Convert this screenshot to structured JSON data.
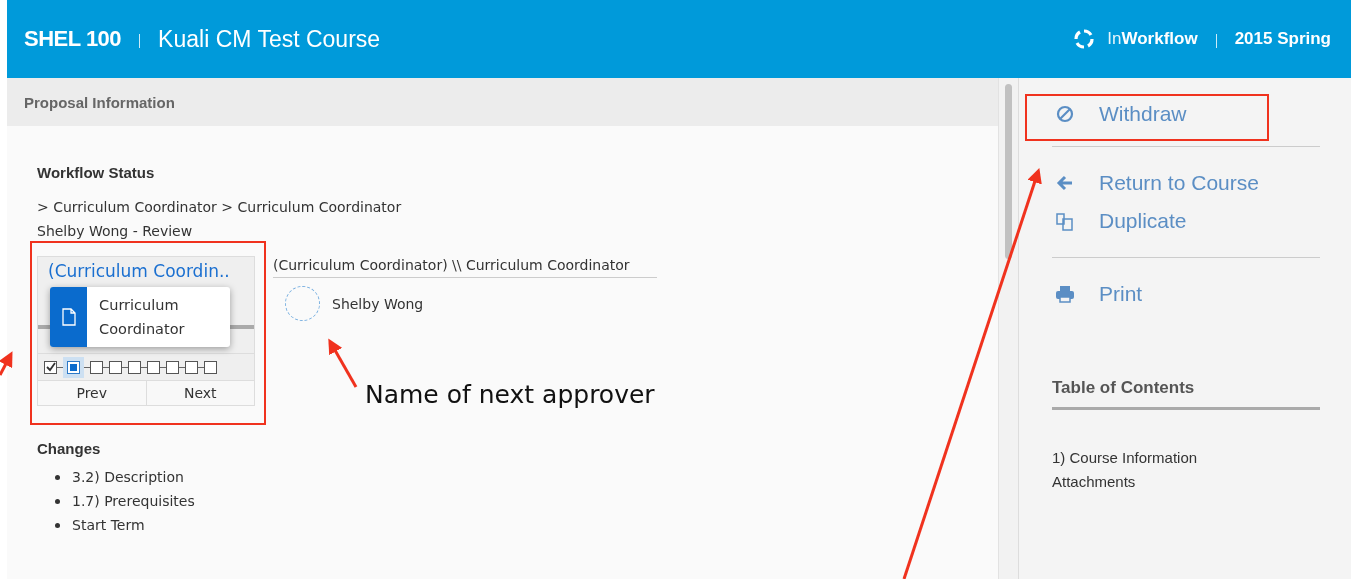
{
  "header": {
    "course_code": "SHEL 100",
    "course_title": "Kuali CM Test Course",
    "status_prefix": "In",
    "status": "Workflow",
    "term": "2015 Spring"
  },
  "panel": {
    "title": "Proposal Information"
  },
  "workflow": {
    "heading": "Workflow Status",
    "path": "> Curriculum Coordinator > Curriculum Coordinator",
    "current": "Shelby Wong - Review",
    "widget": {
      "title": "(Curriculum Coordin..",
      "tooltip": "Curriculum Coordinator",
      "steps": [
        {
          "kind": "done"
        },
        {
          "kind": "current"
        },
        {
          "kind": "pending"
        },
        {
          "kind": "pending"
        },
        {
          "kind": "pending"
        },
        {
          "kind": "pending"
        },
        {
          "kind": "pending"
        },
        {
          "kind": "pending"
        },
        {
          "kind": "pending"
        }
      ],
      "prev": "Prev",
      "next": "Next"
    },
    "node_title": "(Curriculum Coordinator) \\\\ Curriculum Coordinator",
    "approver": "Shelby Wong"
  },
  "changes": {
    "heading": "Changes",
    "items": [
      "3.2) Description",
      "1.7) Prerequisites",
      "Start Term"
    ]
  },
  "action_groups": [
    [
      {
        "kind": "withdraw",
        "label": "Withdraw"
      }
    ],
    [
      {
        "kind": "return",
        "label": "Return to Course"
      },
      {
        "kind": "duplicate",
        "label": "Duplicate"
      }
    ],
    [
      {
        "kind": "print",
        "label": "Print"
      }
    ]
  ],
  "toc": {
    "title": "Table of Contents",
    "items": [
      "1) Course Information",
      "Attachments"
    ]
  },
  "annotations": {
    "callout": "Name of next approver"
  }
}
